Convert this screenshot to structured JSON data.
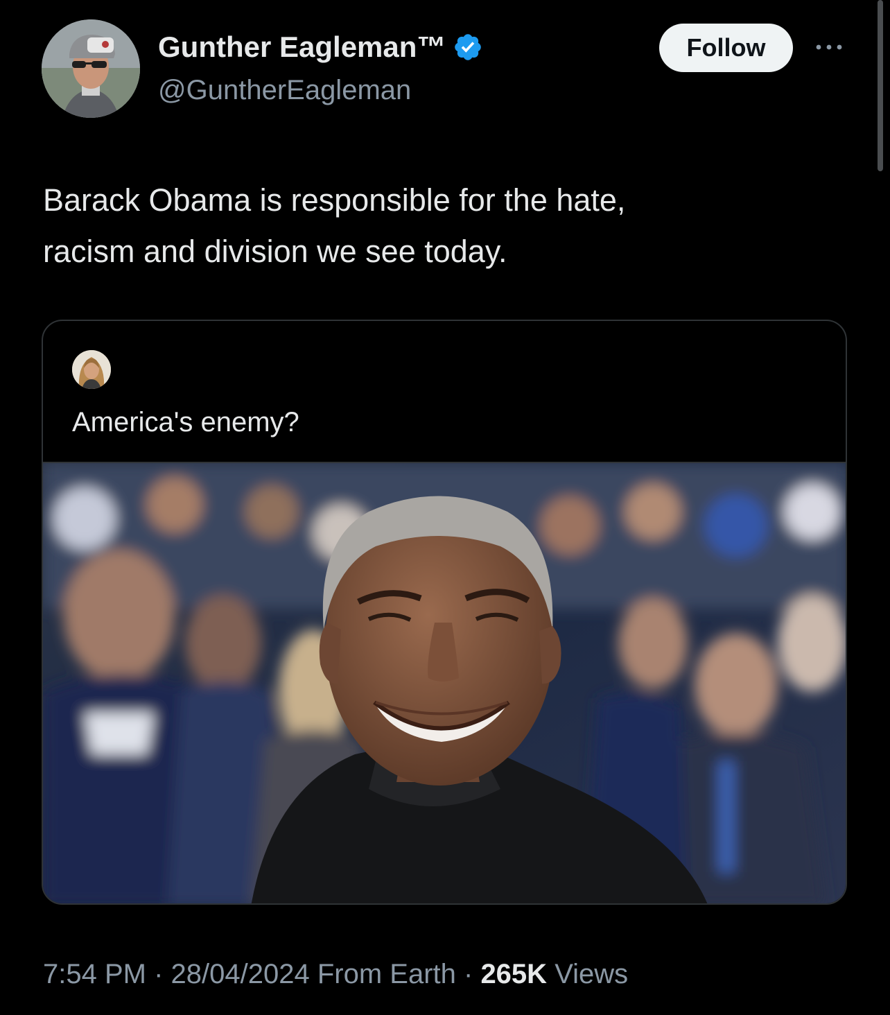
{
  "author": {
    "display_name": "Gunther Eagleman™",
    "handle": "@GuntherEagleman",
    "verified_icon": "verified-badge-icon",
    "verified_color": "#1d9bf0"
  },
  "actions": {
    "follow_label": "Follow",
    "more_icon": "more-dots-icon"
  },
  "tweet": {
    "text_line1": "Barack Obama is responsible for the hate,",
    "text_line2": "racism and division we see today."
  },
  "quoted_tweet": {
    "text": "America's enemy?"
  },
  "meta": {
    "time": "7:54 PM",
    "separator": " · ",
    "date": "28/04/2024",
    "source": "From Earth",
    "views_count": "265K",
    "views_label": "Views"
  },
  "colors": {
    "background": "#000000",
    "text": "#e7e9ea",
    "secondary_text": "#8b98a5",
    "border": "#2f3336",
    "follow_bg": "#eff3f4"
  }
}
